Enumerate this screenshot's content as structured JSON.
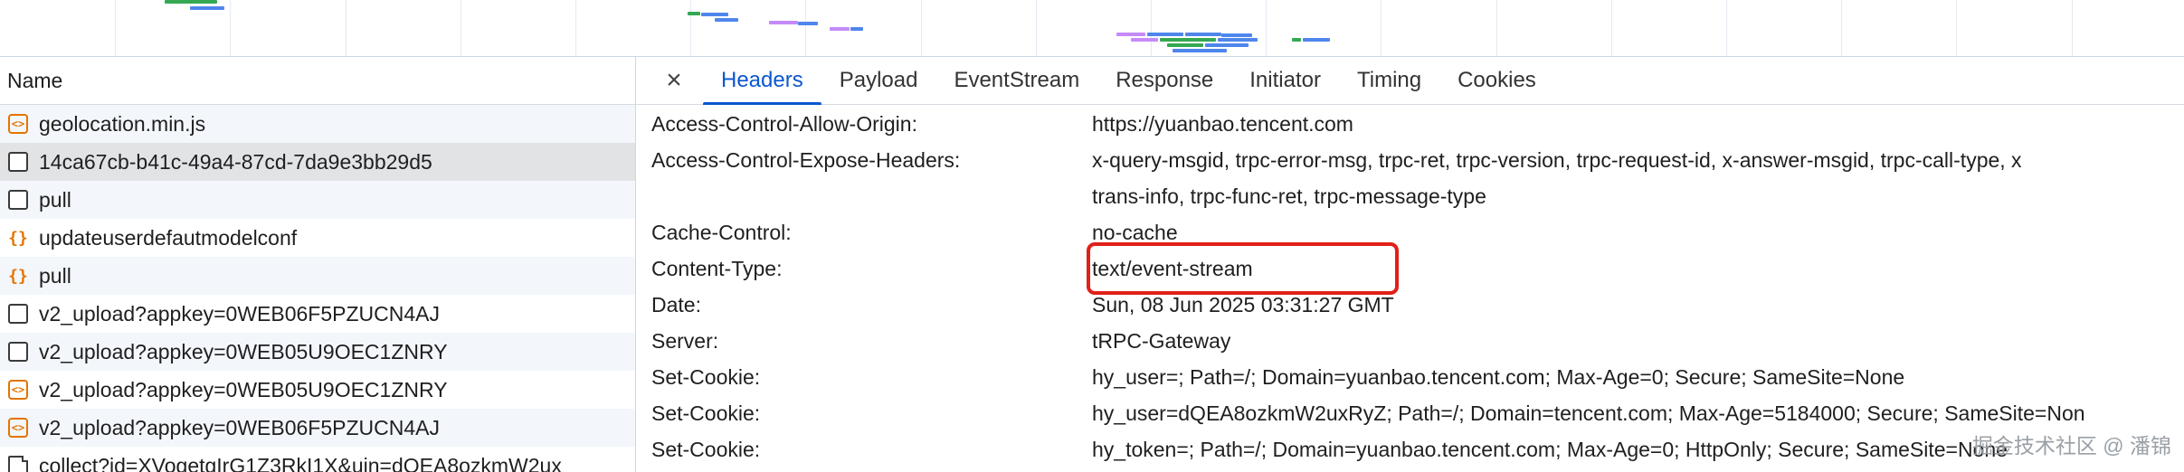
{
  "list": {
    "header": "Name",
    "rows": [
      {
        "name": "geolocation.min.js",
        "icon": "script-file-icon"
      },
      {
        "name": "14ca67cb-b41c-49a4-87cd-7da9e3bb29d5",
        "icon": "document-icon"
      },
      {
        "name": "pull",
        "icon": "document-icon"
      },
      {
        "name": "updateuserdefautmodelconf",
        "icon": "fetch-icon"
      },
      {
        "name": "pull",
        "icon": "fetch-icon"
      },
      {
        "name": "v2_upload?appkey=0WEB06F5PZUCN4AJ",
        "icon": "document-icon"
      },
      {
        "name": "v2_upload?appkey=0WEB05U9OEC1ZNRY",
        "icon": "document-icon"
      },
      {
        "name": "v2_upload?appkey=0WEB05U9OEC1ZNRY",
        "icon": "script-file-icon"
      },
      {
        "name": "v2_upload?appkey=0WEB06F5PZUCN4AJ",
        "icon": "script-file-icon"
      },
      {
        "name": "collect?id=XVogetgIrG1Z3RkI1X&uin=dQEA8ozkmW2ux",
        "icon": "page-icon"
      }
    ]
  },
  "tabs": {
    "close": "×",
    "items": [
      "Headers",
      "Payload",
      "EventStream",
      "Response",
      "Initiator",
      "Timing",
      "Cookies"
    ],
    "active": "Headers"
  },
  "headers": [
    {
      "name": "Access-Control-Allow-Origin:",
      "value": "https://yuanbao.tencent.com"
    },
    {
      "name": "Access-Control-Expose-Headers:",
      "value": "x-query-msgid, trpc-error-msg, trpc-ret, trpc-version, trpc-request-id, x-answer-msgid, trpc-call-type, x"
    },
    {
      "name": "",
      "value": "trans-info, trpc-func-ret, trpc-message-type"
    },
    {
      "name": "Cache-Control:",
      "value": "no-cache"
    },
    {
      "name": "Content-Type:",
      "value": "text/event-stream"
    },
    {
      "name": "Date:",
      "value": "Sun, 08 Jun 2025 03:31:27 GMT"
    },
    {
      "name": "Server:",
      "value": "tRPC-Gateway"
    },
    {
      "name": "Set-Cookie:",
      "value": "hy_user=; Path=/; Domain=yuanbao.tencent.com; Max-Age=0; Secure; SameSite=None"
    },
    {
      "name": "Set-Cookie:",
      "value": "hy_user=dQEA8ozkmW2uxRyZ; Path=/; Domain=tencent.com; Max-Age=5184000; Secure; SameSite=Non"
    },
    {
      "name": "Set-Cookie:",
      "value": "hy_token=; Path=/; Domain=yuanbao.tencent.com; Max-Age=0; HttpOnly; Secure; SameSite=None"
    }
  ],
  "watermark": "掘金技术社区 @ 潘锦",
  "colors": {
    "accent": "#0b57d0",
    "highlight": "#e0201a",
    "script_icon": "#e37400",
    "bar_blue": "#4f86ec",
    "bar_green": "#34a853",
    "bar_violet": "#c58af9"
  }
}
